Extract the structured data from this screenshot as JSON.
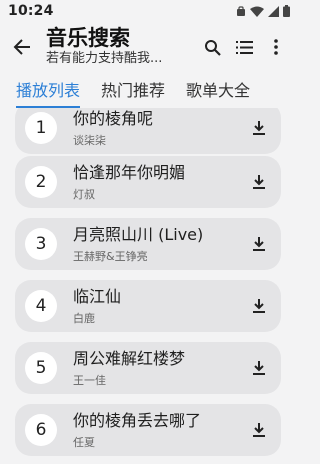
{
  "status": {
    "time": "10:24"
  },
  "appbar": {
    "title": "音乐搜索",
    "subtitle": "若有能力支持酷我..."
  },
  "tabs": [
    {
      "label": "播放列表",
      "active": true
    },
    {
      "label": "热门推荐",
      "active": false
    },
    {
      "label": "歌单大全",
      "active": false
    }
  ],
  "songs": [
    {
      "index": "1",
      "title": "你的棱角呢",
      "artist": "谈柒柒"
    },
    {
      "index": "2",
      "title": "恰逢那年你明媚",
      "artist": "灯叔"
    },
    {
      "index": "3",
      "title": "月亮照山川 (Live)",
      "artist": "王赫野&王铮亮"
    },
    {
      "index": "4",
      "title": "临江仙",
      "artist": "白鹿"
    },
    {
      "index": "5",
      "title": "周公难解红楼梦",
      "artist": "王一佳"
    },
    {
      "index": "6",
      "title": "你的棱角丢去哪了",
      "artist": "任夏"
    }
  ],
  "colors": {
    "accent": "#2c7fd6",
    "card": "#e4e4e6",
    "background": "#f3f3f4"
  },
  "icons": {
    "back": "arrow-left-icon",
    "search": "search-icon",
    "list": "playlist-icon",
    "more": "more-vertical-icon",
    "download": "download-icon"
  }
}
